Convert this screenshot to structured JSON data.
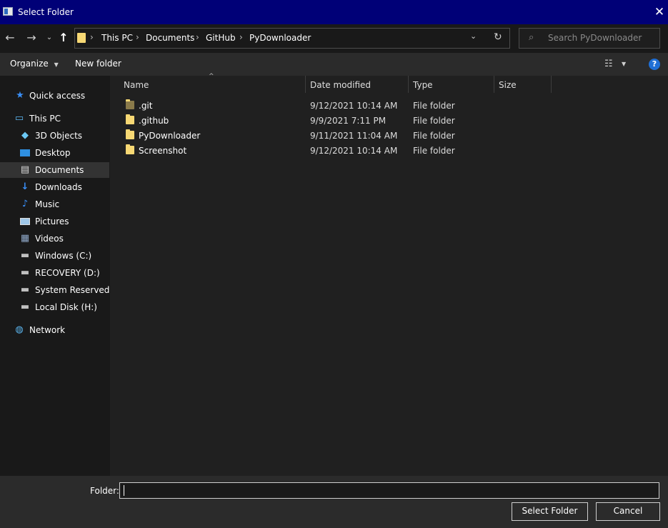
{
  "window": {
    "title": "Select Folder"
  },
  "address": {
    "crumbs": [
      "This PC",
      "Documents",
      "GitHub",
      "PyDownloader"
    ]
  },
  "search": {
    "placeholder": "Search PyDownloader"
  },
  "commands": {
    "organize": "Organize",
    "new_folder": "New folder",
    "help": "?"
  },
  "sidebar": {
    "items": [
      {
        "label": "Quick access",
        "icon": "star-icon"
      },
      {
        "label": "This PC",
        "icon": "computer-icon"
      },
      {
        "label": "3D Objects",
        "icon": "cube-icon"
      },
      {
        "label": "Desktop",
        "icon": "desktop-icon"
      },
      {
        "label": "Documents",
        "icon": "document-icon",
        "selected": true
      },
      {
        "label": "Downloads",
        "icon": "download-arrow-icon"
      },
      {
        "label": "Music",
        "icon": "music-note-icon"
      },
      {
        "label": "Pictures",
        "icon": "picture-icon"
      },
      {
        "label": "Videos",
        "icon": "film-icon"
      },
      {
        "label": "Windows (C:)",
        "icon": "drive-windows-icon"
      },
      {
        "label": "RECOVERY (D:)",
        "icon": "drive-icon"
      },
      {
        "label": "System Reserved (E:",
        "icon": "drive-icon"
      },
      {
        "label": "Local Disk (H:)",
        "icon": "drive-icon"
      },
      {
        "label": "Network",
        "icon": "network-icon"
      }
    ]
  },
  "columns": {
    "name": "Name",
    "date": "Date modified",
    "type": "Type",
    "size": "Size"
  },
  "files": [
    {
      "name": ".git",
      "date": "9/12/2021 10:14 AM",
      "type": "File folder",
      "hidden": true
    },
    {
      "name": ".github",
      "date": "9/9/2021 7:11 PM",
      "type": "File folder"
    },
    {
      "name": "PyDownloader",
      "date": "9/11/2021 11:04 AM",
      "type": "File folder"
    },
    {
      "name": "Screenshot",
      "date": "9/12/2021 10:14 AM",
      "type": "File folder"
    }
  ],
  "footer": {
    "folder_label": "Folder:",
    "folder_value": "",
    "select_button": "Select Folder",
    "cancel_button": "Cancel"
  },
  "colors": {
    "titlebar": "#000077",
    "folder": "#f7d874",
    "help": "#1f6fd6"
  }
}
